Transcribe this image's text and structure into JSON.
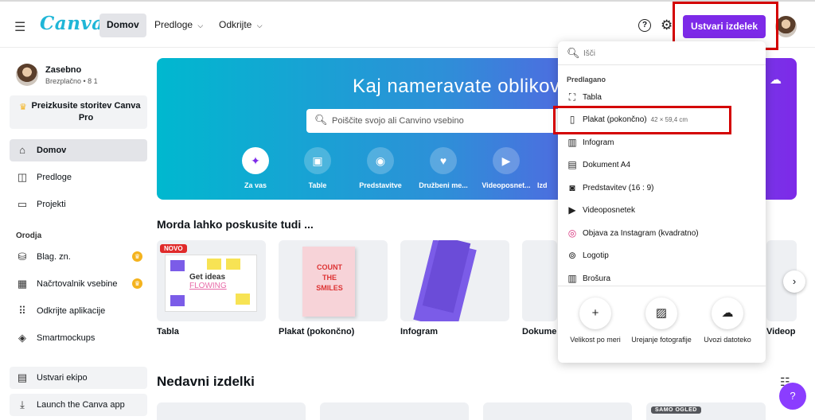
{
  "header": {
    "logo": "Canva",
    "nav": {
      "home": "Domov",
      "templates": "Predloge",
      "discover": "Odkrijte"
    },
    "help": "?",
    "create_button": "Ustvari izdelek"
  },
  "sidebar": {
    "user_name": "Zasebno",
    "user_sub": "Brezplačno • 8 1",
    "pro_cta": "Preizkusite storitev Canva Pro",
    "items": [
      {
        "label": "Domov"
      },
      {
        "label": "Predloge"
      },
      {
        "label": "Projekti"
      }
    ],
    "tools_heading": "Orodja",
    "tools": [
      {
        "label": "Blag. zn."
      },
      {
        "label": "Načrtovalnik vsebine"
      },
      {
        "label": "Odkrijte aplikacije"
      },
      {
        "label": "Smartmockups"
      }
    ],
    "bottom": [
      {
        "label": "Ustvari ekipo"
      },
      {
        "label": "Launch the Canva app"
      }
    ]
  },
  "banner": {
    "title": "Kaj nameravate oblikov",
    "search_placeholder": "Poiščite svojo ali Canvino vsebino",
    "categories": [
      {
        "label": "Za vas"
      },
      {
        "label": "Table"
      },
      {
        "label": "Predstavitve"
      },
      {
        "label": "Družbeni me..."
      },
      {
        "label": "Videoposnet..."
      },
      {
        "label": "Izd"
      }
    ]
  },
  "suggestions": {
    "title": "Morda lahko poskusite tudi ...",
    "badge_new": "NOVO",
    "board_text_1": "Get ideas",
    "board_text_2": "FLOWING",
    "poster_text": "COUNT THE SMILES",
    "cards": [
      {
        "label": "Tabla"
      },
      {
        "label": "Plakat (pokončno)"
      },
      {
        "label": "Infogram"
      },
      {
        "label": "Dokume"
      },
      {
        "label": "Videop"
      }
    ]
  },
  "recent": {
    "title": "Nedavni izdelki",
    "view_only_badge": "SAMO OGLED"
  },
  "dropdown": {
    "search_placeholder": "Išči",
    "heading": "Predlagano",
    "items": [
      {
        "label": "Tabla",
        "dims": ""
      },
      {
        "label": "Plakat (pokončno)",
        "dims": "42 × 59,4 cm"
      },
      {
        "label": "Infogram",
        "dims": ""
      },
      {
        "label": "Dokument A4",
        "dims": ""
      },
      {
        "label": "Predstavitev (16 : 9)",
        "dims": ""
      },
      {
        "label": "Videoposnetek",
        "dims": ""
      },
      {
        "label": "Objava za Instagram (kvadratno)",
        "dims": ""
      },
      {
        "label": "Logotip",
        "dims": ""
      },
      {
        "label": "Brošura",
        "dims": ""
      }
    ],
    "actions": [
      {
        "label": "Velikost po meri"
      },
      {
        "label": "Urejanje fotografije"
      },
      {
        "label": "Uvozi datoteko"
      }
    ]
  },
  "colors": {
    "brand_purple": "#7d2ae8",
    "highlight_red": "#d40000",
    "logo_teal": "#1fb6d7"
  }
}
